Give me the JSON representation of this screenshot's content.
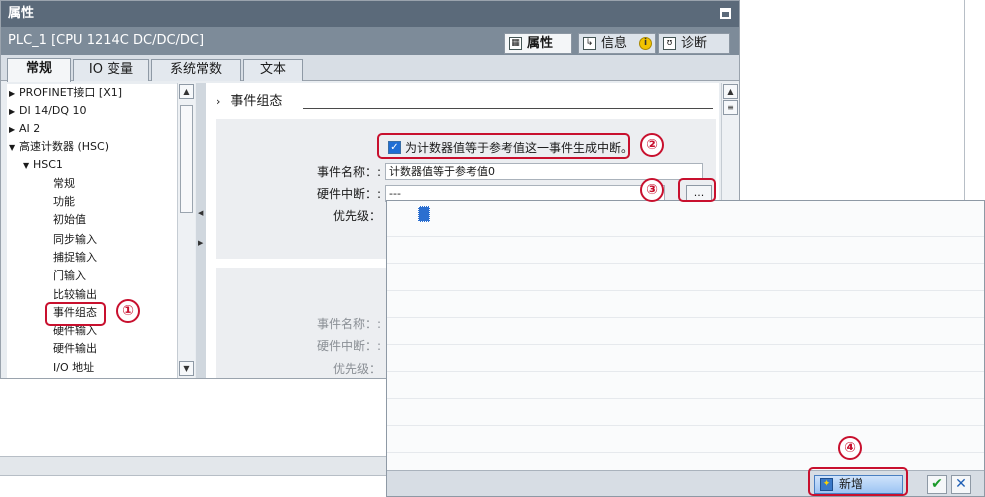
{
  "window": {
    "title": "属性",
    "device": "PLC_1 [CPU 1214C DC/DC/DC]"
  },
  "inspector_tabs": [
    {
      "label": "属性",
      "icon": "properties-icon"
    },
    {
      "label": "信息",
      "icon": "info-icon"
    },
    {
      "label": "诊断",
      "icon": "diagnostics-icon"
    }
  ],
  "info_badge": "i",
  "tabs": [
    {
      "label": "常规"
    },
    {
      "label": "IO 变量"
    },
    {
      "label": "系统常数"
    },
    {
      "label": "文本"
    }
  ],
  "tree": [
    {
      "label": "PROFINET接口 [X1]",
      "expander": "▶"
    },
    {
      "label": "DI 14/DQ 10",
      "expander": "▶"
    },
    {
      "label": "AI 2",
      "expander": "▶"
    },
    {
      "label": "高速计数器 (HSC)",
      "expander": "▼"
    },
    {
      "label": "HSC1",
      "expander": "▼"
    },
    {
      "label": "常规"
    },
    {
      "label": "功能"
    },
    {
      "label": "初始值"
    },
    {
      "label": "同步输入"
    },
    {
      "label": "捕捉输入"
    },
    {
      "label": "门输入"
    },
    {
      "label": "比较输出"
    },
    {
      "label": "事件组态",
      "selected": true
    },
    {
      "label": "硬件输入"
    },
    {
      "label": "硬件输出"
    },
    {
      "label": "I/O 地址"
    }
  ],
  "section": {
    "title": "事件组态",
    "chevron": "›"
  },
  "event1": {
    "checkbox_label": "为计数器值等于参考值这一事件生成中断。",
    "checked": true,
    "name_label": "事件名称：:",
    "name_value": "计数器值等于参考值0",
    "hw_label": "硬件中断：:",
    "hw_value": "---",
    "browse_label": "...",
    "priority_label": "优先级："
  },
  "event2": {
    "name_label": "事件名称：:",
    "hw_label": "硬件中断：:",
    "priority_label": "优先级："
  },
  "popup": {
    "add_label": "新增",
    "ok_glyph": "✔",
    "cancel_glyph": "✕"
  },
  "callouts": [
    "①",
    "②",
    "③",
    "④"
  ],
  "annotation_color": "#c8102e",
  "scroll": {
    "up": "▲",
    "down": "▼",
    "grip": "≡"
  }
}
